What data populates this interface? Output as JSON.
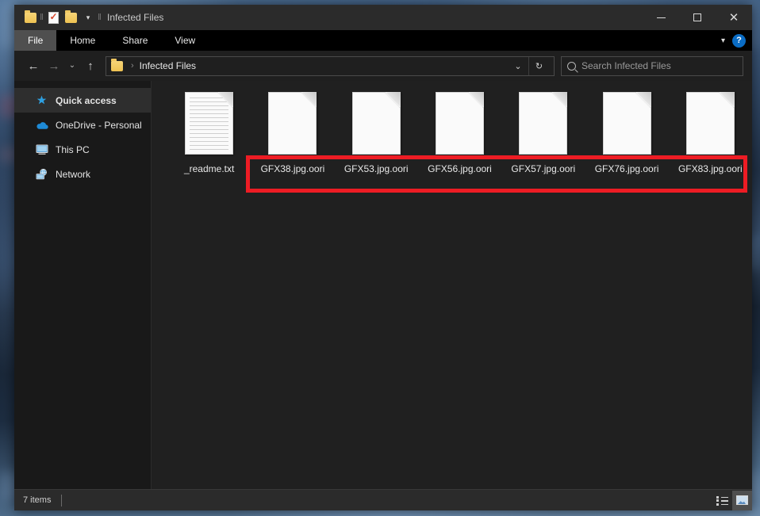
{
  "window": {
    "title": "Infected Files",
    "quick_access_toolbar": [
      {
        "name": "folder-icon",
        "label": "Folder"
      },
      {
        "name": "separator",
        "label": "|"
      },
      {
        "name": "properties-icon",
        "label": "Properties"
      },
      {
        "name": "new-folder-icon",
        "label": "New folder"
      },
      {
        "name": "chevron-down-icon",
        "label": "Customize Quick Access Toolbar"
      },
      {
        "name": "separator",
        "label": "|"
      }
    ],
    "controls": {
      "minimize": "—",
      "maximize": "□",
      "close": "✕"
    }
  },
  "ribbon": {
    "tabs": [
      {
        "label": "File",
        "active": true
      },
      {
        "label": "Home",
        "active": false
      },
      {
        "label": "Share",
        "active": false
      },
      {
        "label": "View",
        "active": false
      }
    ],
    "collapse_label": "⌄",
    "help_label": "?"
  },
  "addressbar": {
    "back": "←",
    "forward": "→",
    "recent": "⌄",
    "up": "↑",
    "breadcrumb_separator": "›",
    "path_text": "Infected Files",
    "dropdown": "⌄",
    "refresh": "↻"
  },
  "search": {
    "placeholder": "Search Infected Files",
    "value": ""
  },
  "sidebar": {
    "items": [
      {
        "label": "Quick access",
        "icon": "star-icon",
        "selected": true
      },
      {
        "label": "OneDrive - Personal",
        "icon": "cloud-icon",
        "selected": false
      },
      {
        "label": "This PC",
        "icon": "monitor-icon",
        "selected": false
      },
      {
        "label": "Network",
        "icon": "network-icon",
        "selected": false
      }
    ]
  },
  "files": [
    {
      "name": "_readme.txt",
      "icon": "text-document-icon",
      "highlighted": false
    },
    {
      "name": "GFX38.jpg.oori",
      "icon": "blank-document-icon",
      "highlighted": true
    },
    {
      "name": "GFX53.jpg.oori",
      "icon": "blank-document-icon",
      "highlighted": true
    },
    {
      "name": "GFX56.jpg.oori",
      "icon": "blank-document-icon",
      "highlighted": true
    },
    {
      "name": "GFX57.jpg.oori",
      "icon": "blank-document-icon",
      "highlighted": true
    },
    {
      "name": "GFX76.jpg.oori",
      "icon": "blank-document-icon",
      "highlighted": true
    },
    {
      "name": "GFX83.jpg.oori",
      "icon": "blank-document-icon",
      "highlighted": true
    }
  ],
  "annotation": {
    "color": "#ed1c24",
    "description": "Red rectangle highlighting the encrypted .oori file names"
  },
  "statusbar": {
    "item_count": "7 items",
    "views": [
      {
        "name": "details-view",
        "active": false
      },
      {
        "name": "large-icons-view",
        "active": true
      }
    ]
  },
  "colors": {
    "window_bg": "#1f1f1f",
    "sidebar_bg": "#191919",
    "content_bg": "#202020",
    "titlebar_bg": "#2b2b2b",
    "ribbon_bg": "#000000",
    "accent_red": "#ed1c24",
    "help_blue": "#0a6cc4"
  }
}
